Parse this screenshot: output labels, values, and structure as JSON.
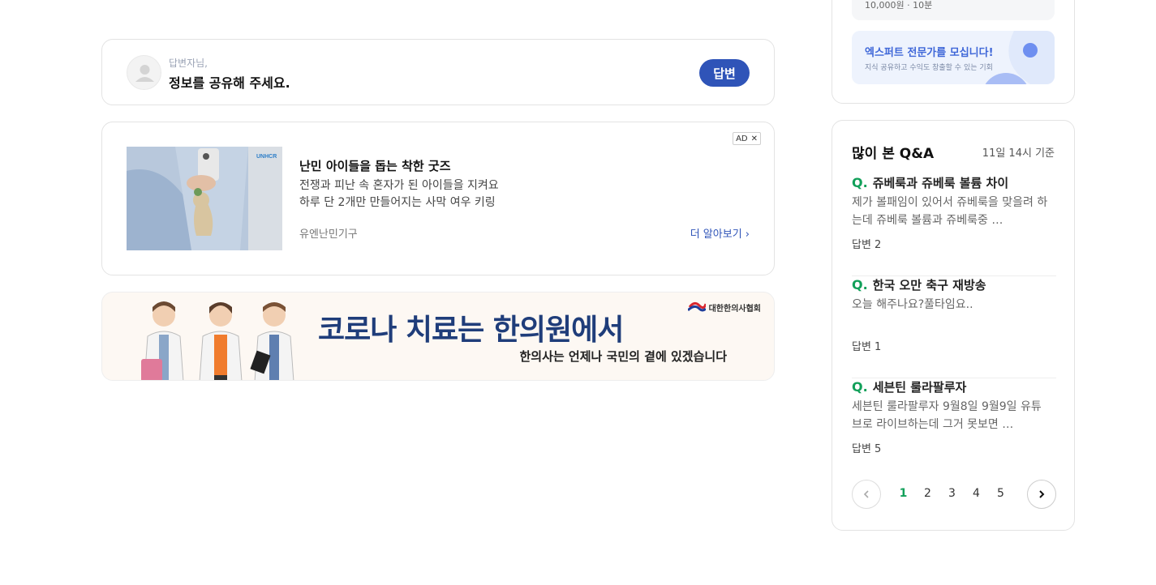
{
  "answer_prompt": {
    "small_text": "답변자님,",
    "main_text": "정보를 공유해 주세요.",
    "button_label": "답변"
  },
  "ad": {
    "badge": "AD",
    "title": "난민 아이들을 돕는 착한 굿즈",
    "desc_line1": "전쟁과 피난 속 혼자가 된 아이들을 지켜요",
    "desc_line2": "하루 단 2개만 만들어지는 사막 여우 키링",
    "advertiser": "유엔난민기구",
    "more_label": "더 알아보기",
    "thumb_logo": "UNHCR"
  },
  "banner": {
    "headline": "코로나 치료는 한의원에서",
    "subline": "한의사는 언제나 국민의 곁에 있겠습니다",
    "logo_text": "대한한의사협회"
  },
  "expert": {
    "partial_text": "10,000원 · 10분",
    "title": "엑스퍼트 전문가를 모십니다!",
    "desc": "지식 공유하고 수익도 창출할 수 있는 기회"
  },
  "popular_qa": {
    "title": "많이 본 Q&A",
    "basis": "11일 14시 기준",
    "q_mark": "Q.",
    "items": [
      {
        "question": "쥬베룩과 쥬베룩 볼륨 차이",
        "body": "제가 볼패임이 있어서 쥬베룩을 맞을려 하는데 쥬베룩 볼륨과 쥬베룩중 …",
        "answers": "답변 2"
      },
      {
        "question": "한국 오만 축구 재방송",
        "body": "오늘 해주나요?풀타임요..",
        "answers": "답변 1"
      },
      {
        "question": "세븐틴 룰라팔루자",
        "body": "세븐틴 룰라팔루자 9월8일 9월9일 유튜브로 라이브하는데 그거 못보면 …",
        "answers": "답변 5"
      }
    ],
    "pages": [
      "1",
      "2",
      "3",
      "4",
      "5"
    ],
    "active_page": "1"
  },
  "colors": {
    "accent_blue": "#2f54b8",
    "qa_green": "#12a05a",
    "banner_navy": "#1f3d7a"
  }
}
